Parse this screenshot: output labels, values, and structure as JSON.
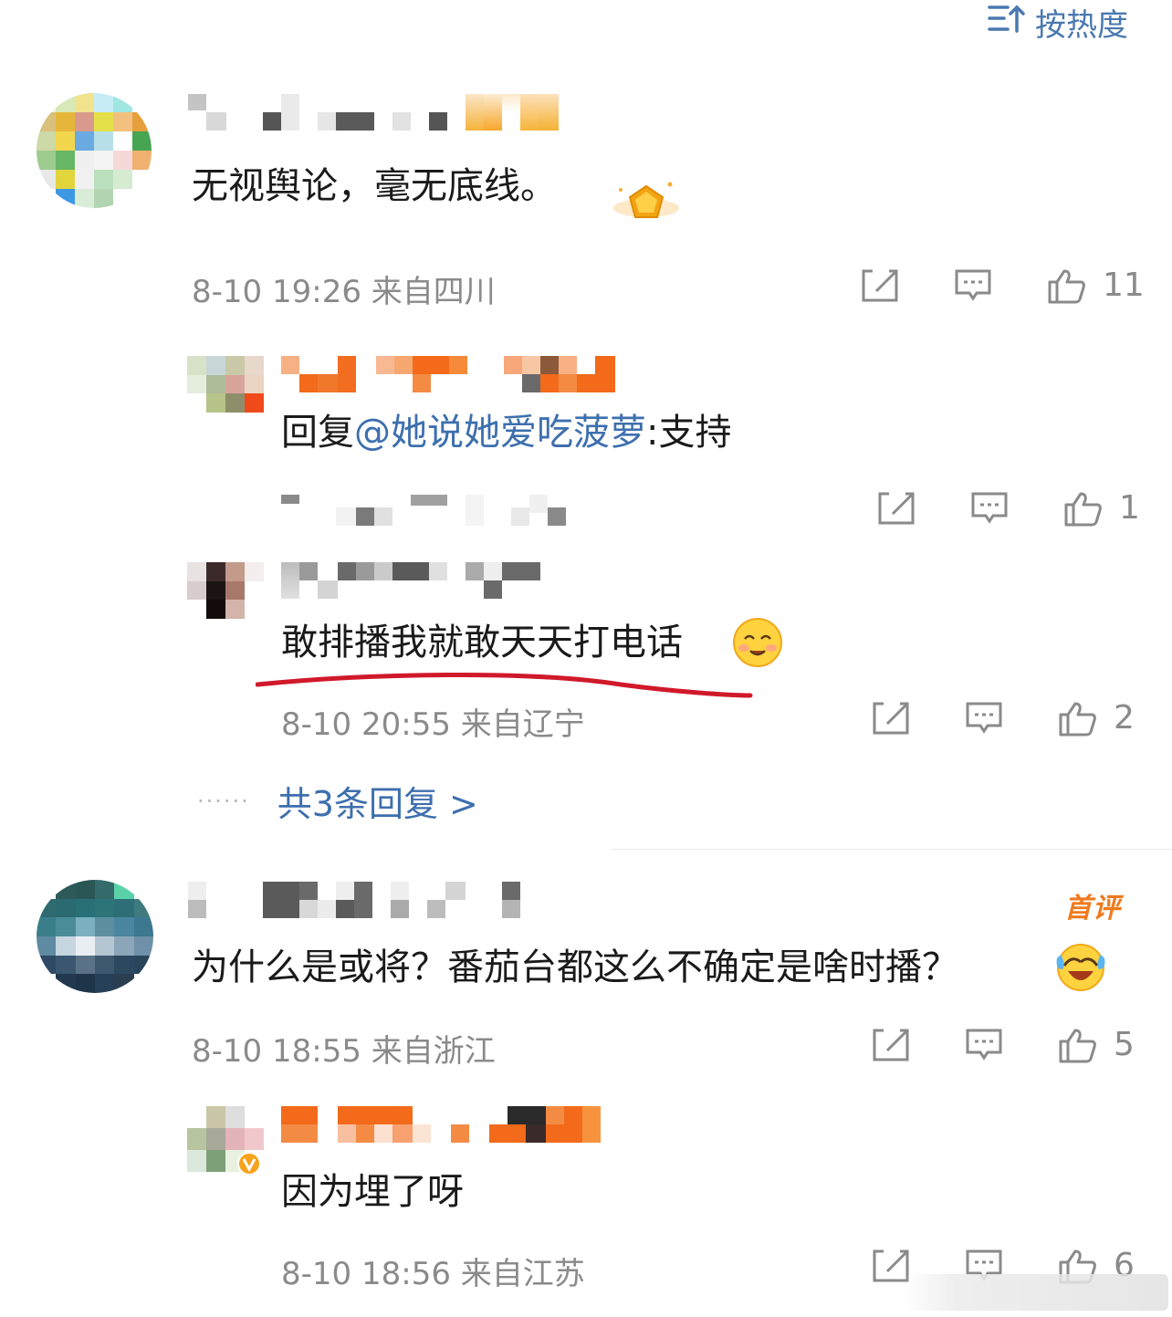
{
  "sort": {
    "icon": "sort-icon",
    "label": "按热度"
  },
  "comments": [
    {
      "text": "无视舆论，毫无底线。",
      "meta": "8-10 19:26  来自四川",
      "likes": "11",
      "replies": [
        {
          "prefix": "回复",
          "mention": "@她说她爱吃菠萝",
          "text": ":支持",
          "meta": "",
          "likes": "1"
        },
        {
          "text": "敢排播我就敢天天打电话",
          "emoji": "smile-emoji",
          "meta": "8-10 20:55  来自辽宁",
          "likes": "2"
        }
      ],
      "more": "共3条回复 >"
    },
    {
      "badge": "首评",
      "text": "为什么是或将？番茄台都这么不确定是啥时播？",
      "emoji": "laugh-cry-emoji",
      "meta": "8-10 18:55  来自浙江",
      "likes": "5",
      "replies": [
        {
          "text": "因为埋了呀",
          "meta": "8-10 18:56  来自江苏",
          "likes": "6"
        }
      ]
    }
  ],
  "colors": {
    "link": "#3d6fae",
    "meta": "#8a8a8a",
    "underline": "#d0192a",
    "badge": "#f07a1e"
  }
}
